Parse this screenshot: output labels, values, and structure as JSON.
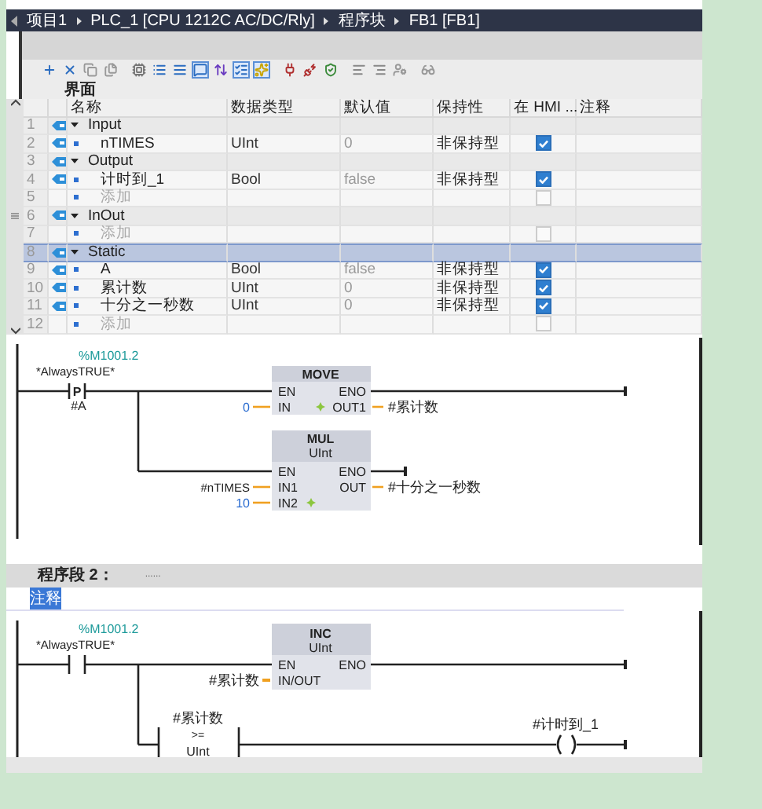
{
  "breadcrumb": [
    "项目1",
    "PLC_1 [CPU 1212C AC/DC/Rly]",
    "程序块",
    "FB1 [FB1]"
  ],
  "toolbar": [
    {
      "selected": false
    },
    {
      "selected": false
    },
    {
      "selected": false
    },
    {
      "selected": false
    },
    {
      "selected": false
    },
    {
      "selected": false
    },
    {
      "selected": false
    },
    {
      "selected": true
    },
    {
      "selected": false
    },
    {
      "selected": true
    },
    {
      "selected": true
    },
    {
      "selected": false
    },
    {
      "selected": false
    },
    {
      "selected": false
    },
    {
      "selected": false
    },
    {
      "selected": false
    },
    {
      "selected": false
    },
    {
      "selected": false
    }
  ],
  "interface_title": "界面",
  "table": {
    "columns": [
      "名称",
      "数据类型",
      "默认值",
      "保持性",
      "在 HMI ...",
      "注释"
    ],
    "rows": [
      {
        "no": "1",
        "kind": "section",
        "name": "Input",
        "expanded": true,
        "selected": false
      },
      {
        "no": "2",
        "kind": "item",
        "name": "nTIMES",
        "type": "UInt",
        "default": "0",
        "retain": "非保持型",
        "hmi": true,
        "selected": false
      },
      {
        "no": "3",
        "kind": "section",
        "name": "Output",
        "expanded": true,
        "selected": false
      },
      {
        "no": "4",
        "kind": "item",
        "name": "计时到_1",
        "type": "Bool",
        "default": "false",
        "retain": "非保持型",
        "hmi": true,
        "selected": false
      },
      {
        "no": "5",
        "kind": "add",
        "name": "添加",
        "hmi": false,
        "selected": false
      },
      {
        "no": "6",
        "kind": "section",
        "name": "InOut",
        "expanded": true,
        "selected": false
      },
      {
        "no": "7",
        "kind": "add",
        "name": "添加",
        "hmi": false,
        "selected": false
      },
      {
        "no": "8",
        "kind": "section",
        "name": "Static",
        "expanded": true,
        "selected": true
      },
      {
        "no": "9",
        "kind": "item",
        "name": "A",
        "type": "Bool",
        "default": "false",
        "retain": "非保持型",
        "hmi": true,
        "selected": false
      },
      {
        "no": "10",
        "kind": "item",
        "name": "累计数",
        "type": "UInt",
        "default": "0",
        "retain": "非保持型",
        "hmi": true,
        "selected": false
      },
      {
        "no": "11",
        "kind": "item",
        "name": "十分之一秒数",
        "type": "UInt",
        "default": "0",
        "retain": "非保持型",
        "hmi": true,
        "selected": false
      },
      {
        "no": "12",
        "kind": "add",
        "name": "添加",
        "hmi": false,
        "selected": false
      }
    ]
  },
  "network1": {
    "contact": {
      "kind": "positive_edge",
      "address": "%M1001.2",
      "symbol": "*AlwaysTRUE*",
      "operand": "#A",
      "edge_mark": "P"
    },
    "move": {
      "title": "MOVE",
      "en": "EN",
      "eno": "ENO",
      "in": "IN",
      "out": "OUT1",
      "in_value": "0",
      "out_value": "#累计数"
    },
    "mul": {
      "title": "MUL",
      "type": "UInt",
      "en": "EN",
      "eno": "ENO",
      "in1": "IN1",
      "in2": "IN2",
      "out": "OUT",
      "in1_value": "#nTIMES",
      "in2_value": "10",
      "out_value": "#十分之一秒数"
    }
  },
  "network2": {
    "title": "程序段 2：",
    "title_extra": "......",
    "comment": "注释",
    "contact": {
      "kind": "normally_open",
      "address": "%M1001.2",
      "symbol": "*AlwaysTRUE*"
    },
    "inc": {
      "title": "INC",
      "type": "UInt",
      "en": "EN",
      "eno": "ENO",
      "inout": "IN/OUT",
      "inout_value": "#累计数"
    },
    "compare": {
      "operand": "#累计数",
      "op": ">=",
      "type": "UInt"
    },
    "coil": {
      "operand": "#计时到_1"
    }
  }
}
